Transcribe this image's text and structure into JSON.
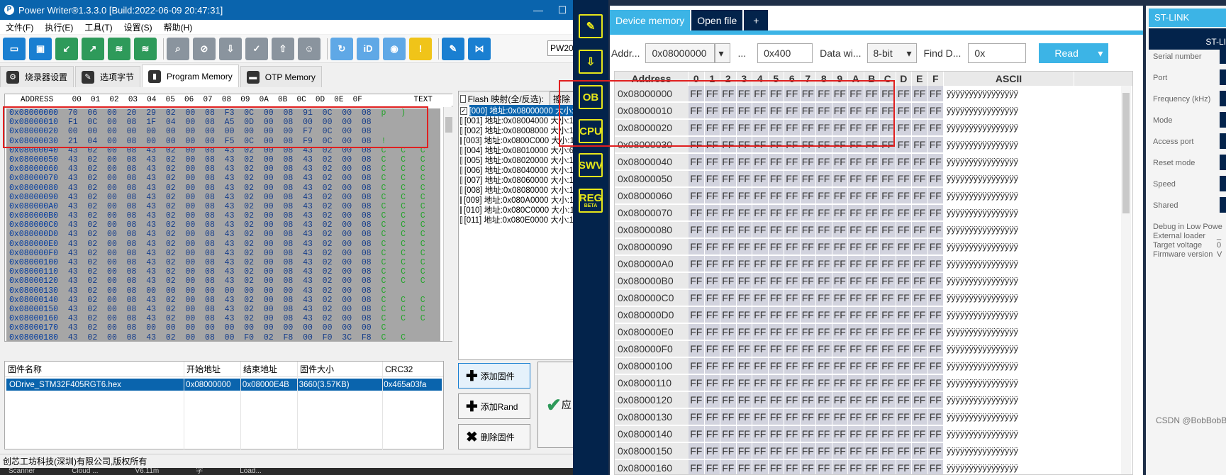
{
  "power_writer": {
    "title": "Power Writer®1.3.3.0 [Build:2022-06-09 20:47:31]",
    "menu": [
      "文件(F)",
      "执行(E)",
      "工具(T)",
      "设置(S)",
      "帮助(H)"
    ],
    "pw_field": "PW20",
    "tabs": [
      {
        "label": "烧录器设置",
        "icon": "gear-icon"
      },
      {
        "label": "选项字节",
        "icon": "wrench-icon"
      },
      {
        "label": "Program Memory",
        "icon": "chip-icon"
      },
      {
        "label": "OTP Memory",
        "icon": "disk-icon"
      }
    ],
    "hex_header": "ADDRESS    00  01  02  03  04  05  06  07  08  09  0A  0B  0C  0D  0E  0F           TEXT",
    "hex_rows": [
      {
        "addr": "0x08000000",
        "bytes": "70  06  00  20  29  02  00  08  F3  0C  00  08  91  0C  00  08",
        "text": "p   )         "
      },
      {
        "addr": "0x08000010",
        "bytes": "F1  0C  00  08  1F  04  00  08  A5  0D  00  08  00  00  00  08",
        "text": "              "
      },
      {
        "addr": "0x08000020",
        "bytes": "00  00  00  00  00  00  00  00  00  00  00  00  F7  0C  00  08",
        "text": "              "
      },
      {
        "addr": "0x08000030",
        "bytes": "21  04  00  08  00  00  00  00  F5  0C  00  08  F9  0C  00  08",
        "text": "!             "
      },
      {
        "addr": "0x08000040",
        "bytes": "43  02  00  08  43  02  00  08  43  02  00  08  43  02  00  08",
        "text": "C   C   C   C "
      },
      {
        "addr": "0x08000050",
        "bytes": "43  02  00  08  43  02  00  08  43  02  00  08  43  02  00  08",
        "text": "C   C   C   C "
      },
      {
        "addr": "0x08000060",
        "bytes": "43  02  00  08  43  02  00  08  43  02  00  08  43  02  00  08",
        "text": "C   C   C   C "
      },
      {
        "addr": "0x08000070",
        "bytes": "43  02  00  08  43  02  00  08  43  02  00  08  43  02  00  08",
        "text": "C   C   C   C "
      },
      {
        "addr": "0x08000080",
        "bytes": "43  02  00  08  43  02  00  08  43  02  00  08  43  02  00  08",
        "text": "C   C   C   C "
      },
      {
        "addr": "0x08000090",
        "bytes": "43  02  00  08  43  02  00  08  43  02  00  08  43  02  00  08",
        "text": "C   C   C   C "
      },
      {
        "addr": "0x080000A0",
        "bytes": "43  02  00  08  43  02  00  08  43  02  00  08  43  02  00  08",
        "text": "C   C   C   C "
      },
      {
        "addr": "0x080000B0",
        "bytes": "43  02  00  08  43  02  00  08  43  02  00  08  43  02  00  08",
        "text": "C   C   C   C "
      },
      {
        "addr": "0x080000C0",
        "bytes": "43  02  00  08  43  02  00  08  43  02  00  08  43  02  00  08",
        "text": "C   C   C   C "
      },
      {
        "addr": "0x080000D0",
        "bytes": "43  02  00  08  43  02  00  08  43  02  00  08  43  02  00  08",
        "text": "C   C   C   C "
      },
      {
        "addr": "0x080000E0",
        "bytes": "43  02  00  08  43  02  00  08  43  02  00  08  43  02  00  08",
        "text": "C   C   C   C "
      },
      {
        "addr": "0x080000F0",
        "bytes": "43  02  00  08  43  02  00  08  43  02  00  08  43  02  00  08",
        "text": "C   C   C   C "
      },
      {
        "addr": "0x08000100",
        "bytes": "43  02  00  08  43  02  00  08  43  02  00  08  43  02  00  08",
        "text": "C   C   C   C "
      },
      {
        "addr": "0x08000110",
        "bytes": "43  02  00  08  43  02  00  08  43  02  00  08  43  02  00  08",
        "text": "C   C   C   C "
      },
      {
        "addr": "0x08000120",
        "bytes": "43  02  00  08  43  02  00  08  43  02  00  08  43  02  00  08",
        "text": "C   C   C   C "
      },
      {
        "addr": "0x08000130",
        "bytes": "43  02  00  08  00  00  00  00  00  00  00  00  43  02  00  08",
        "text": "C           C "
      },
      {
        "addr": "0x08000140",
        "bytes": "43  02  00  08  43  02  00  08  43  02  00  08  43  02  00  08",
        "text": "C   C   C   C "
      },
      {
        "addr": "0x08000150",
        "bytes": "43  02  00  08  43  02  00  08  43  02  00  08  43  02  00  08",
        "text": "C   C   C   C "
      },
      {
        "addr": "0x08000160",
        "bytes": "43  02  00  08  43  02  00  08  43  02  00  08  43  02  00  08",
        "text": "C   C   C   C "
      },
      {
        "addr": "0x08000170",
        "bytes": "43  02  00  08  00  00  00  00  00  00  00  00  00  00  00  00",
        "text": "C             "
      },
      {
        "addr": "0x08000180",
        "bytes": "43  02  00  08  43  02  00  08  00  F0  02  F8  00  F0  3C  F8",
        "text": "C   C         "
      }
    ],
    "flash_header": {
      "label": "Flash 映射(全/反选):",
      "erase": "擦除"
    },
    "flash_items": [
      "[000] 地址:0x08000000 大小:1",
      "[001] 地址:0x08004000 大小:1",
      "[002] 地址:0x08008000 大小:1",
      "[003] 地址:0x0800C000 大小:1",
      "[004] 地址:0x08010000 大小:6",
      "[005] 地址:0x08020000 大小:1",
      "[006] 地址:0x08040000 大小:1",
      "[007] 地址:0x08060000 大小:1",
      "[008] 地址:0x08080000 大小:1",
      "[009] 地址:0x080A0000 大小:1",
      "[010] 地址:0x080C0000 大小:1",
      "[011] 地址:0x080E0000 大小:1"
    ],
    "file_table": {
      "headers": [
        "固件名称",
        "开始地址",
        "结束地址",
        "固件大小",
        "CRC32"
      ],
      "rows": [
        [
          "ODrive_STM32F405RGT6.hex",
          "0x08000000",
          "0x08000E4B",
          "3660(3.57KB)",
          "0x465a03fa"
        ]
      ]
    },
    "side_buttons": [
      "添加固件",
      "添加Rand",
      "删除固件"
    ],
    "big_button_label": "应",
    "status": "创芯工坊科技(深圳)有限公司,版权所有",
    "taskbar": [
      "Scanner",
      "Cloud ...",
      "V6.11m",
      "字",
      "Load..."
    ]
  },
  "cube": {
    "sidebar": [
      "OB",
      "CPU",
      "SWV",
      "REG"
    ],
    "sidebar_sub": "BETA",
    "tabs": [
      "Device memory",
      "Open file",
      "+"
    ],
    "form": {
      "addr_label": "Addr...",
      "addr_value": "0x08000000",
      "dots": "...",
      "size_value": "0x400",
      "width_label": "Data wi...",
      "width_value": "8-bit",
      "find_label": "Find D...",
      "find_value": "0x",
      "read_label": "Read"
    },
    "table_headers": {
      "address": "Address",
      "cols": [
        "0",
        "1",
        "2",
        "3",
        "4",
        "5",
        "6",
        "7",
        "8",
        "9",
        "A",
        "B",
        "C",
        "D",
        "E",
        "F"
      ],
      "ascii": "ASCII"
    },
    "rows": [
      "0x08000000",
      "0x08000010",
      "0x08000020",
      "0x08000030",
      "0x08000040",
      "0x08000050",
      "0x08000060",
      "0x08000070",
      "0x08000080",
      "0x08000090",
      "0x080000A0",
      "0x080000B0",
      "0x080000C0",
      "0x080000D0",
      "0x080000E0",
      "0x080000F0",
      "0x08000100",
      "0x08000110",
      "0x08000120",
      "0x08000130",
      "0x08000140",
      "0x08000150",
      "0x08000160"
    ],
    "byte_value": "FF",
    "ascii_value": "ÿÿÿÿÿÿÿÿÿÿÿÿÿÿÿÿ",
    "stlink": {
      "title": "ST-LINK",
      "sub": "ST-LI",
      "labels": [
        "Serial number",
        "Port",
        "Frequency (kHz)",
        "Mode",
        "Access port",
        "Reset mode",
        "Speed",
        "Shared"
      ],
      "info": [
        "Debug in Low Powe",
        "External loader",
        "Target voltage",
        "Firmware version"
      ],
      "info_values": [
        "",
        "_",
        "0",
        "V"
      ]
    }
  },
  "watermark": "CSDN @BobBobBao",
  "colors": {
    "highlight_box": "#e02020",
    "cube_accent": "#3cb4e6",
    "cube_navy": "#03234b",
    "pw_blue": "#0a64ad"
  }
}
